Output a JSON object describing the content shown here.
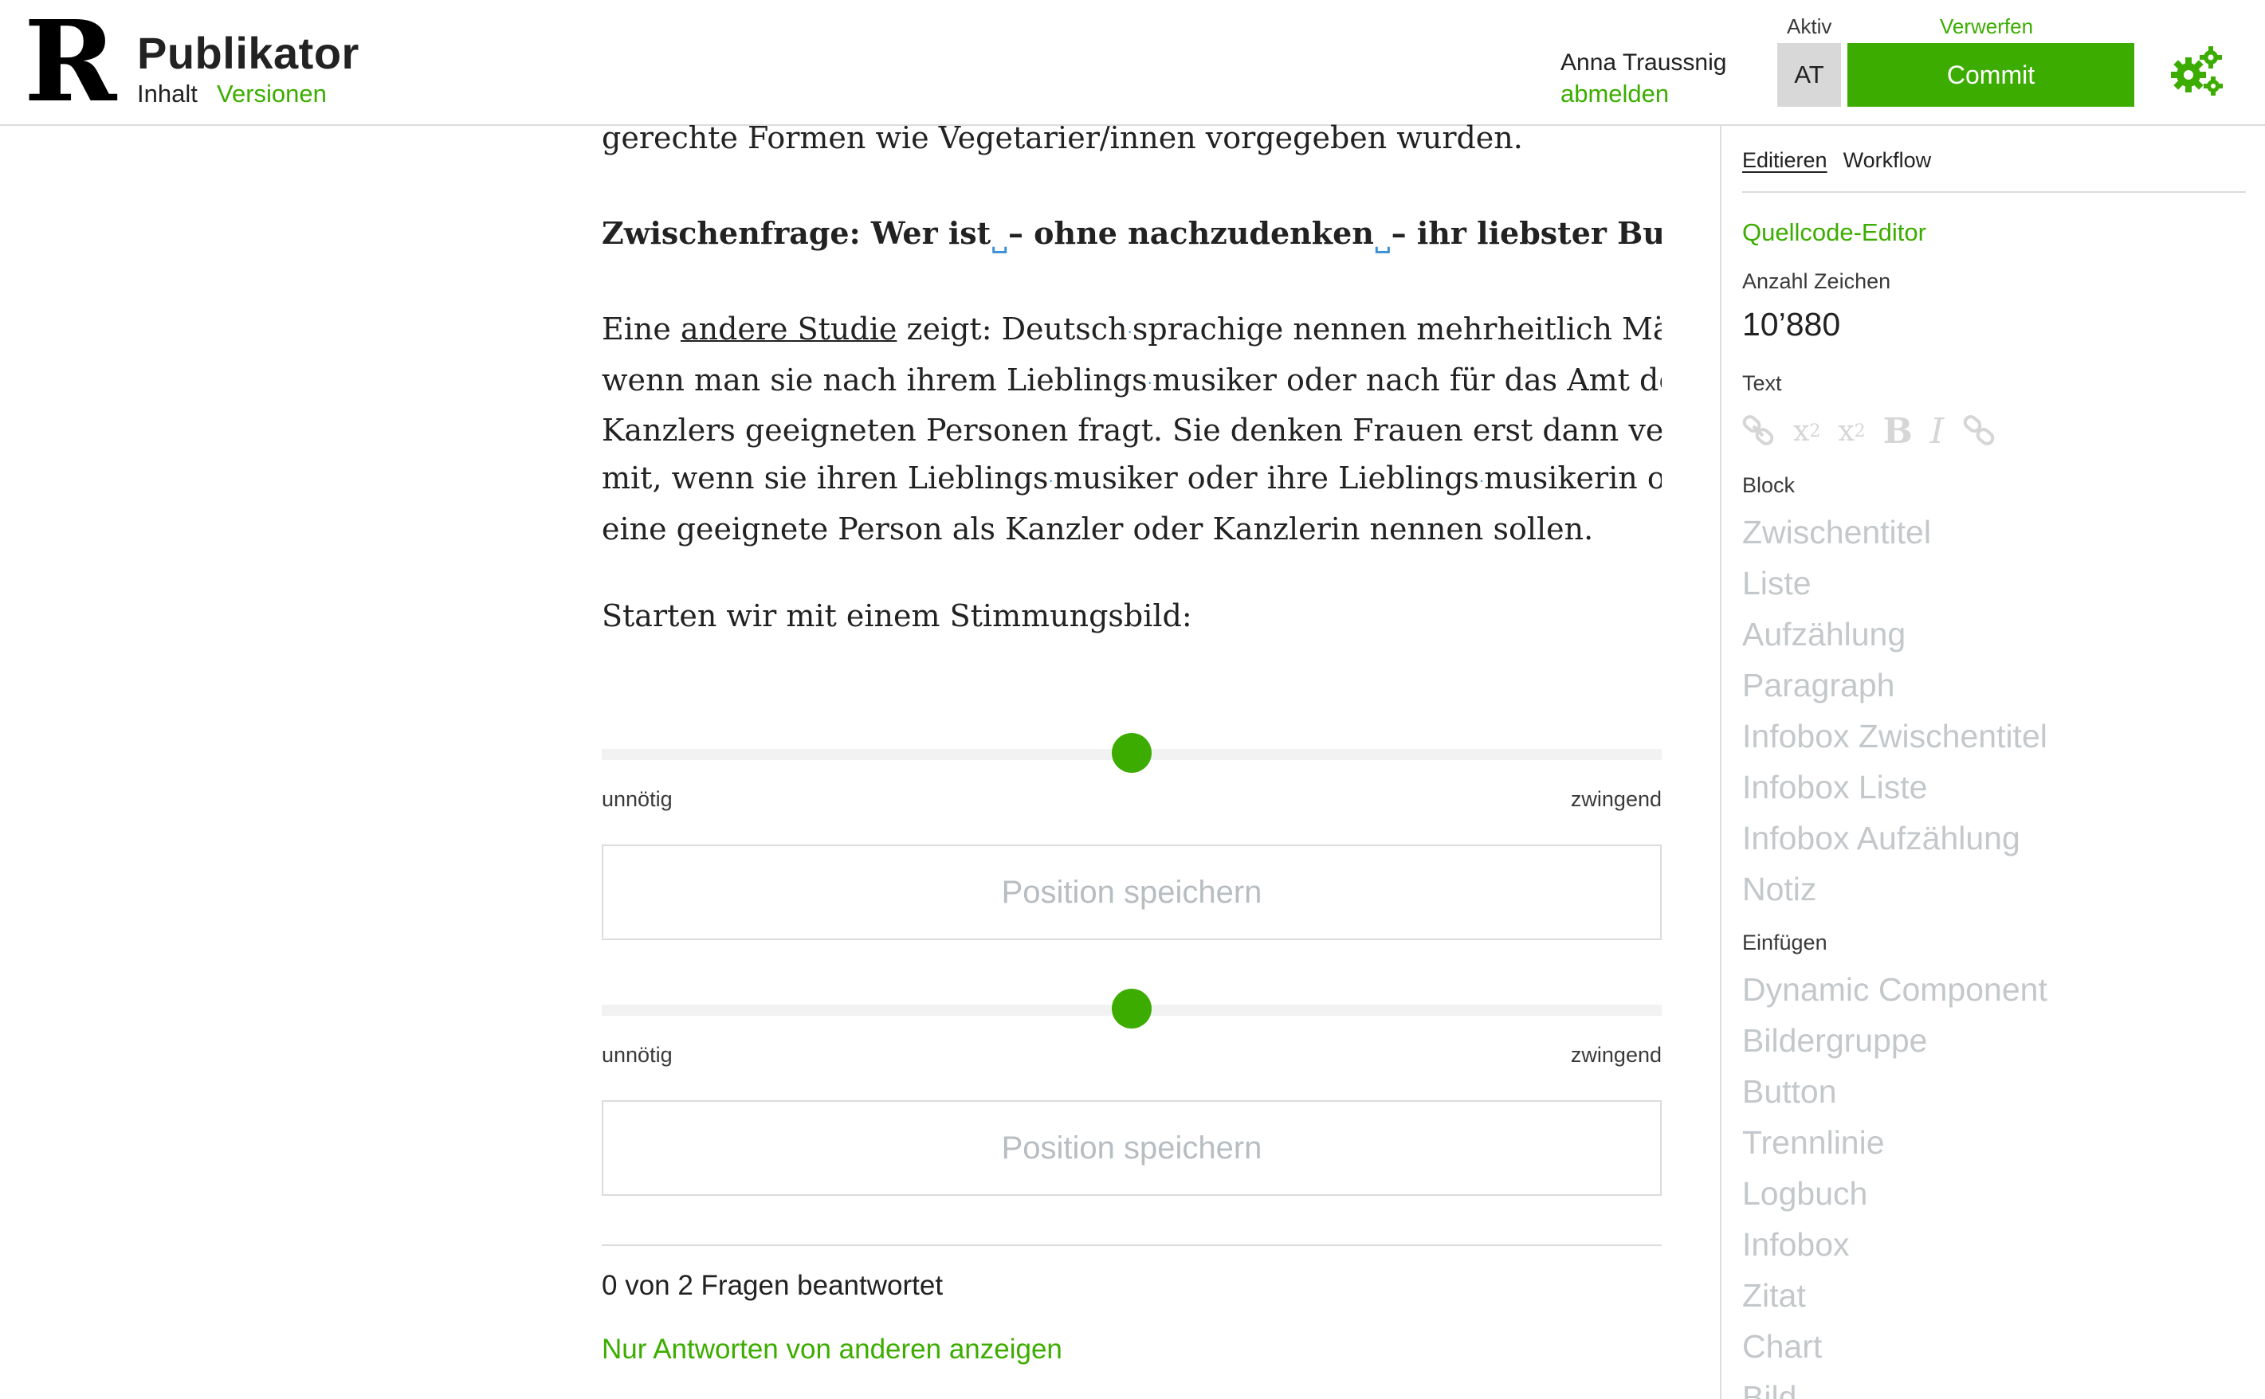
{
  "header": {
    "app_title": "Publikator",
    "nav_inhalt": "Inhalt",
    "nav_versionen": "Versionen",
    "user_name": "Anna Traussnig",
    "logout": "abmelden",
    "aktiv_label": "Aktiv",
    "avatar_initials": "AT",
    "verwerfen": "Verwerfen",
    "commit": "Commit",
    "gear_icon": "gears-icon",
    "accent_color": "#3cad00"
  },
  "article": {
    "cut_line": "gerechte Formen wie Vegetarier/innen vorgegeben wurden.",
    "question_heading": {
      "part1": "Zwischenfrage: Wer ist",
      "part2": "– ohne nachzudenken",
      "part3": "– ihr liebster Bundesrat?"
    },
    "paragraph": {
      "l1_a": "Eine ",
      "l1_link": "andere Studie",
      "l1_b": " zeigt: Deutsch",
      "l1_c": "sprachige nennen mehrheitlich Männer,",
      "l2_a": "wenn man sie nach ihrem Lieblings",
      "l2_b": "musiker oder nach für das Amt des",
      "l3": "Kanzlers geeigneten Personen fragt. Sie denken Frauen erst dann vermehrt",
      "l4_a": "mit, wenn sie ihren Lieblings",
      "l4_b": "musiker oder ihre Lieblings",
      "l4_c": "musikerin oder",
      "l5": "eine geeignete Person als Kanzler oder Kanzlerin nennen sollen."
    },
    "intro": "Starten wir mit einem Stimmungsbild:"
  },
  "sliders": [
    {
      "min_label": "unnötig",
      "max_label": "zwingend",
      "value_fraction": 0.5,
      "save_label": "Position speichern"
    },
    {
      "min_label": "unnötig",
      "max_label": "zwingend",
      "value_fraction": 0.5,
      "save_label": "Position speichern"
    }
  ],
  "poll_footer": {
    "answered": "0 von 2 Fragen beantwortet",
    "others_link": "Nur Antworten von anderen anzeigen"
  },
  "sidebar": {
    "tabs": [
      "Editieren",
      "Workflow"
    ],
    "source_editor": "Quellcode-Editor",
    "char_count_label": "Anzahl Zeichen",
    "char_count": "10’880",
    "text_label": "Text",
    "text_tools": [
      "link-icon",
      "subscript-icon",
      "superscript-icon",
      "bold-icon",
      "italic-icon",
      "unlink-icon"
    ],
    "text_tool_glyphs": {
      "sub": "x",
      "sub_mark": "2",
      "sup": "x",
      "sup_mark": "2",
      "bold": "B",
      "italic": "I"
    },
    "block_label": "Block",
    "block_items": [
      "Zwischentitel",
      "Liste",
      "Aufzählung",
      "Paragraph",
      "Infobox Zwischentitel",
      "Infobox Liste",
      "Infobox Aufzählung",
      "Notiz"
    ],
    "insert_label": "Einfügen",
    "insert_items": [
      "Dynamic Component",
      "Bildergruppe",
      "Button",
      "Trennlinie",
      "Logbuch",
      "Infobox",
      "Zitat",
      "Chart",
      "Bild"
    ]
  }
}
